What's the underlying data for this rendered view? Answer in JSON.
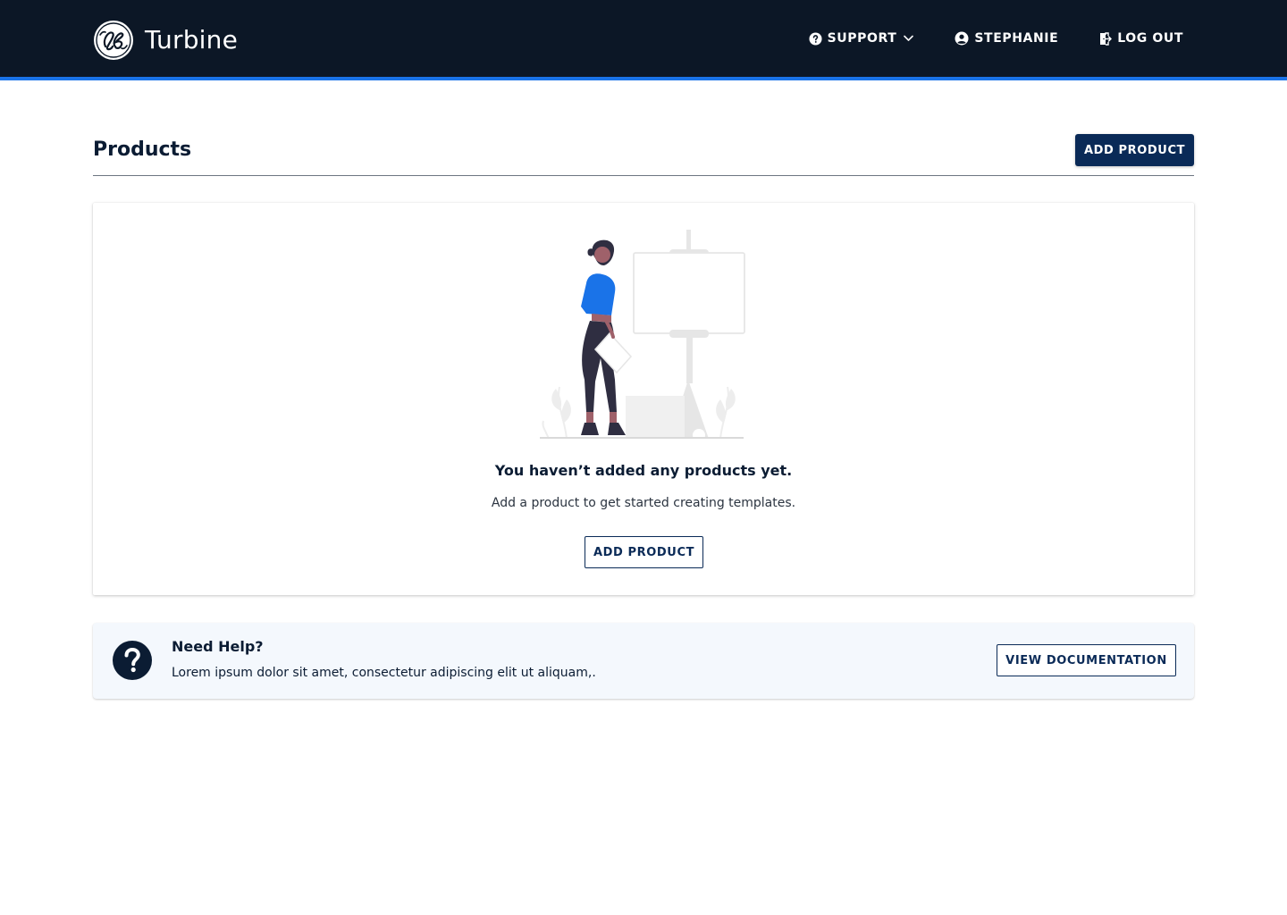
{
  "header": {
    "brand_name": "Turbine",
    "nav": {
      "support_label": "SUPPORT",
      "user_label": "STEPHANIE",
      "logout_label": "LOG OUT"
    }
  },
  "page": {
    "title": "Products",
    "add_button_label": "ADD PRODUCT"
  },
  "empty_state": {
    "title": "You haven’t added any products yet.",
    "subtitle": "Add a product to get started creating templates.",
    "button_label": "ADD PRODUCT"
  },
  "help": {
    "title": "Need Help?",
    "text": "Lorem ipsum dolor sit amet, consectetur adipiscing elit ut aliquam,.",
    "button_label": "VIEW DOCUMENTATION"
  },
  "colors": {
    "header_bg": "#0c1726",
    "accent": "#1a73e8",
    "primary": "#0a2a57",
    "help_bg": "#f4f8fd"
  }
}
